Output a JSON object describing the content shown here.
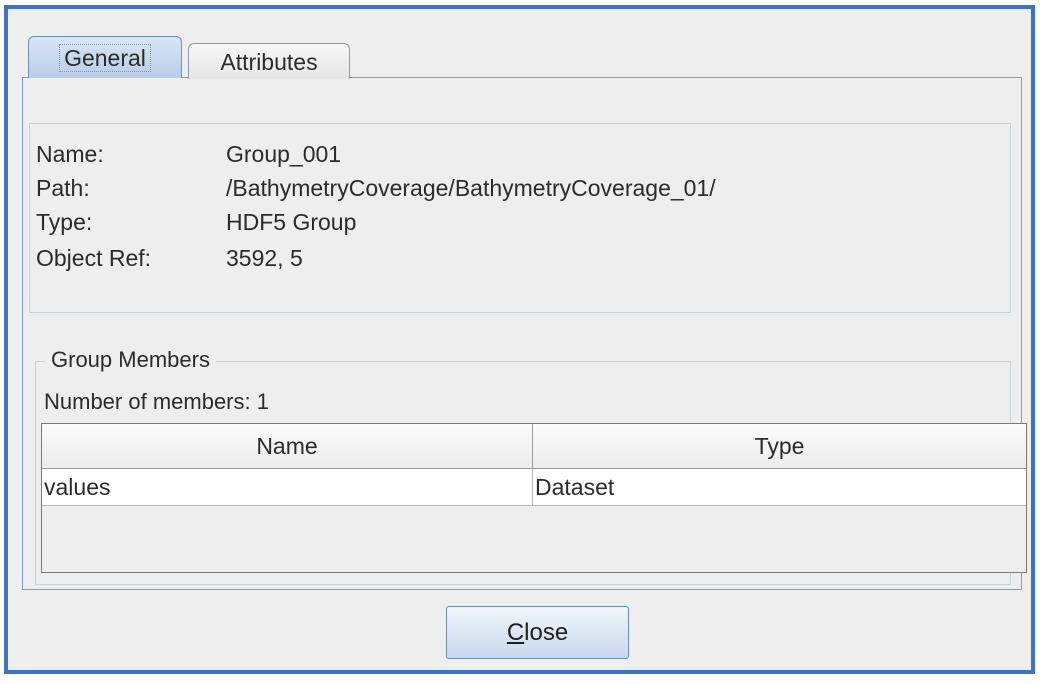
{
  "tabs": [
    {
      "label": "General",
      "selected": true
    },
    {
      "label": "Attributes",
      "selected": false
    }
  ],
  "general": {
    "name_label": "Name:",
    "name_value": "Group_001",
    "path_label": "Path:",
    "path_value": "/BathymetryCoverage/BathymetryCoverage_01/",
    "type_label": "Type:",
    "type_value": "HDF5 Group",
    "ref_label": "Object Ref:",
    "ref_value": "3592, 5"
  },
  "group_members": {
    "title": "Group Members",
    "count_text": "Number of members: 1",
    "columns": [
      "Name",
      "Type"
    ],
    "rows": [
      [
        "values",
        "Dataset"
      ]
    ]
  },
  "close_button": {
    "mnemonic": "C",
    "rest": "lose"
  },
  "colors": {
    "window_border": "#3c73c7",
    "background": "#eeeeee",
    "selected_tab": "#c4d6ee"
  }
}
